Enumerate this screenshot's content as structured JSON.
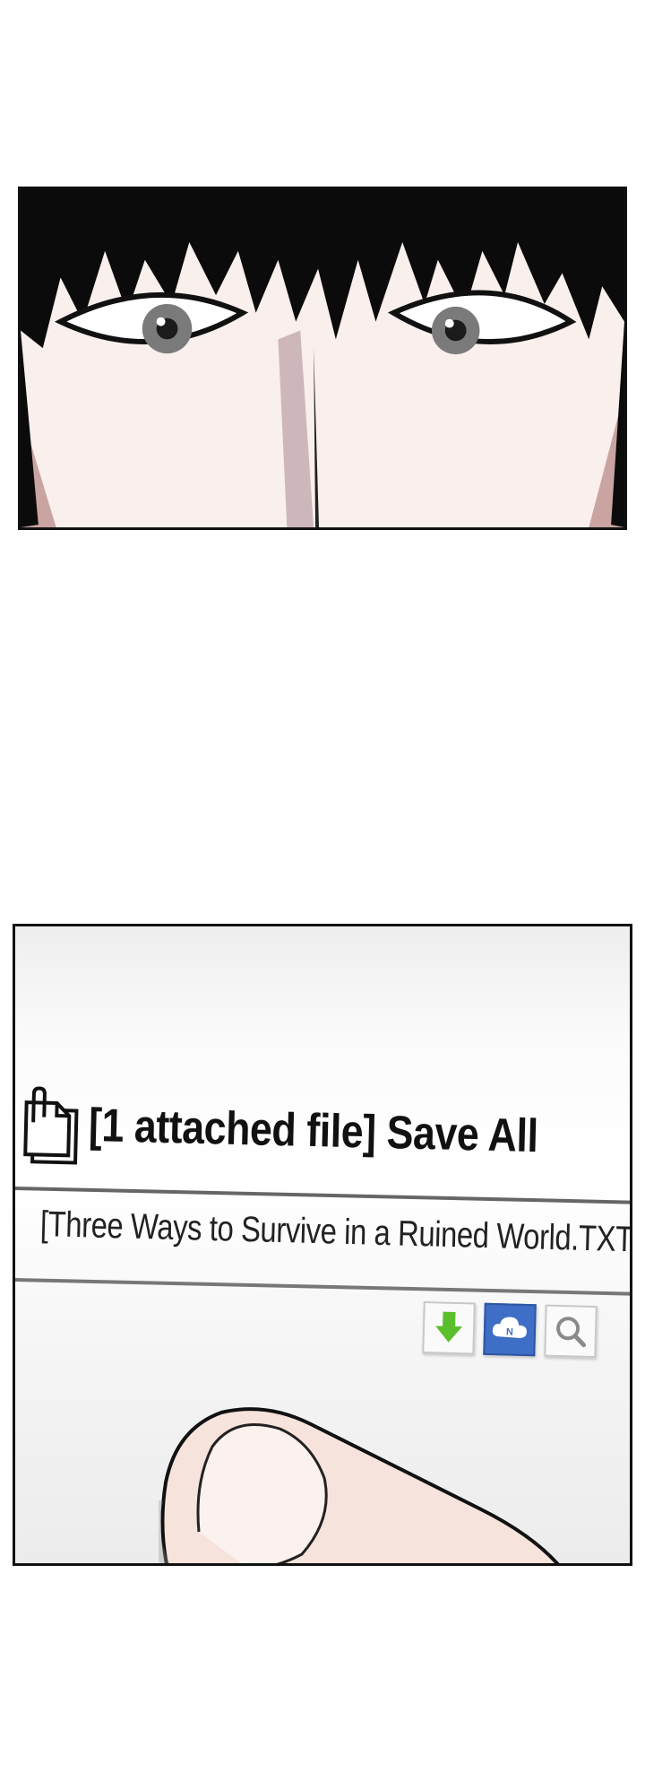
{
  "attachment": {
    "title": "[1 attached file] Save All",
    "file_name": "[Three Ways to Survive in a Ruined World.TXT]",
    "buttons": [
      {
        "id": "download",
        "icon": "download-arrow-icon",
        "color": "#5bbf2b"
      },
      {
        "id": "cloud-save",
        "icon": "cloud-icon",
        "badge": "N",
        "color": "#3f6ec6"
      },
      {
        "id": "preview",
        "icon": "magnifier-icon",
        "color": "#8a8a8a"
      }
    ]
  }
}
